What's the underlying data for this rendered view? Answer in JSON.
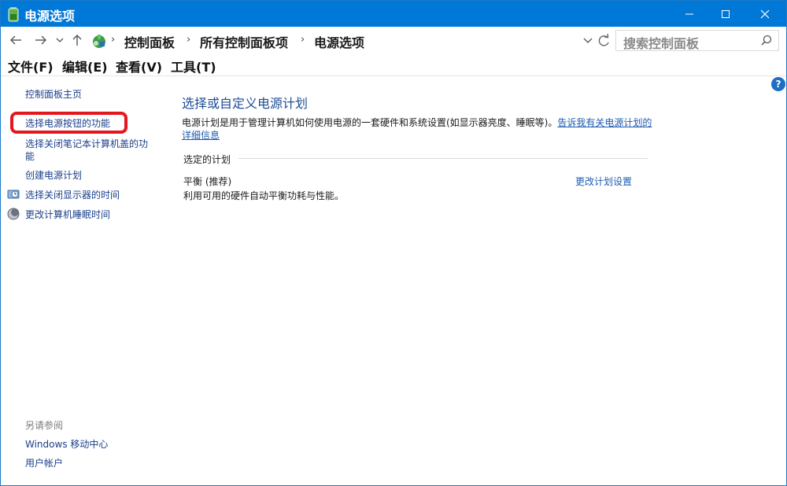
{
  "window": {
    "title": "电源选项"
  },
  "address": {
    "breadcrumbs": [
      "控制面板",
      "所有控制面板项",
      "电源选项"
    ],
    "search_placeholder": "搜索控制面板"
  },
  "menu": [
    "文件(F)",
    "编辑(E)",
    "查看(V)",
    "工具(T)"
  ],
  "help_label": "?",
  "sidebar": {
    "home": "控制面板主页",
    "items": [
      {
        "label": "选择电源按钮的功能",
        "icon": "none",
        "highlighted": true
      },
      {
        "label_line1": "选择关闭笔记本计算机盖的功",
        "label_line2": "能",
        "icon": "none"
      },
      {
        "label": "创建电源计划",
        "icon": "none"
      },
      {
        "label": "选择关闭显示器的时间",
        "icon": "display-clock-icon"
      },
      {
        "label": "更改计算机睡眠时间",
        "icon": "moon-icon"
      }
    ],
    "see_also_title": "另请参阅",
    "see_also": [
      "Windows 移动中心",
      "用户帐户"
    ]
  },
  "main": {
    "title": "选择或自定义电源计划",
    "description": "电源计划是用于管理计算机如何使用电源的一套硬件和系统设置(如显示器亮度、睡眠等)。",
    "description_link": "告诉我有关电源计划的详细信息",
    "section_label": "选定的计划",
    "plan": {
      "name": "平衡 (推荐)",
      "description": "利用可用的硬件自动平衡功耗与性能。",
      "change_link": "更改计划设置"
    }
  },
  "colors": {
    "titlebar": "#0078d7",
    "link": "#1e5bb0",
    "highlight": "#e3171d"
  }
}
